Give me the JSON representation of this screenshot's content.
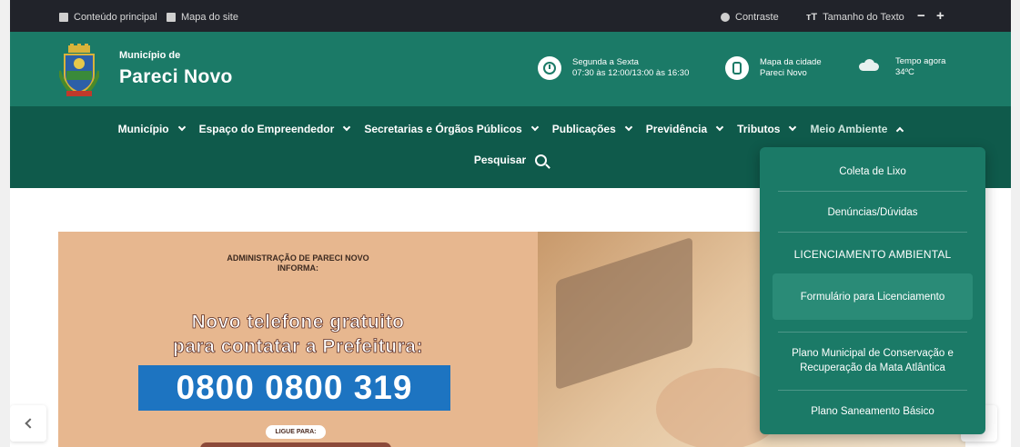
{
  "topbar": {
    "skip_main": "Conteúdo principal",
    "sitemap": "Mapa do site",
    "contrast": "Contraste",
    "text_size": "Tamanho do Texto",
    "decrease": "−",
    "increase": "+"
  },
  "header": {
    "small_title": "Município de",
    "big_title": "Pareci Novo",
    "hours_line1": "Segunda a Sexta",
    "hours_line2": "07:30 às 12:00/13:00 às 16:30",
    "map_line1": "Mapa da cidade",
    "map_line2": "Pareci Novo",
    "weather_line1": "Tempo agora",
    "weather_line2": "34ºC"
  },
  "nav": {
    "items": [
      {
        "label": "Município"
      },
      {
        "label": "Espaço do Empreendedor"
      },
      {
        "label": "Secretarias e Órgãos Públicos"
      },
      {
        "label": "Publicações"
      },
      {
        "label": "Previdência"
      },
      {
        "label": "Tributos"
      },
      {
        "label": "Meio Ambiente"
      }
    ],
    "search_label": "Pesquisar"
  },
  "dropdown": {
    "items": [
      "Coleta de Lixo",
      "Denúncias/Dúvidas",
      "LICENCIAMENTO AMBIENTAL",
      "Formulário para Licenciamento",
      "Plano Municipal de Conservação e Recuperação da Mata Atlântica",
      "Plano Saneamento Básico"
    ]
  },
  "banner": {
    "admin_line1": "ADMINISTRAÇÃO DE PARECI NOVO",
    "admin_line2": "INFORMA:",
    "headline1": "Novo telefone gratuito",
    "headline2": "para contatar a Prefeitura:",
    "phone": "0800 0800 319",
    "call_label": "LIGUE PARA:"
  },
  "colors": {
    "topbar": "#21232a",
    "header": "#1b7a67",
    "nav": "#0f5a4b",
    "dropdown": "#1b7a67",
    "banner_left": "#e7b78f",
    "phone_box": "#1d74c1"
  }
}
